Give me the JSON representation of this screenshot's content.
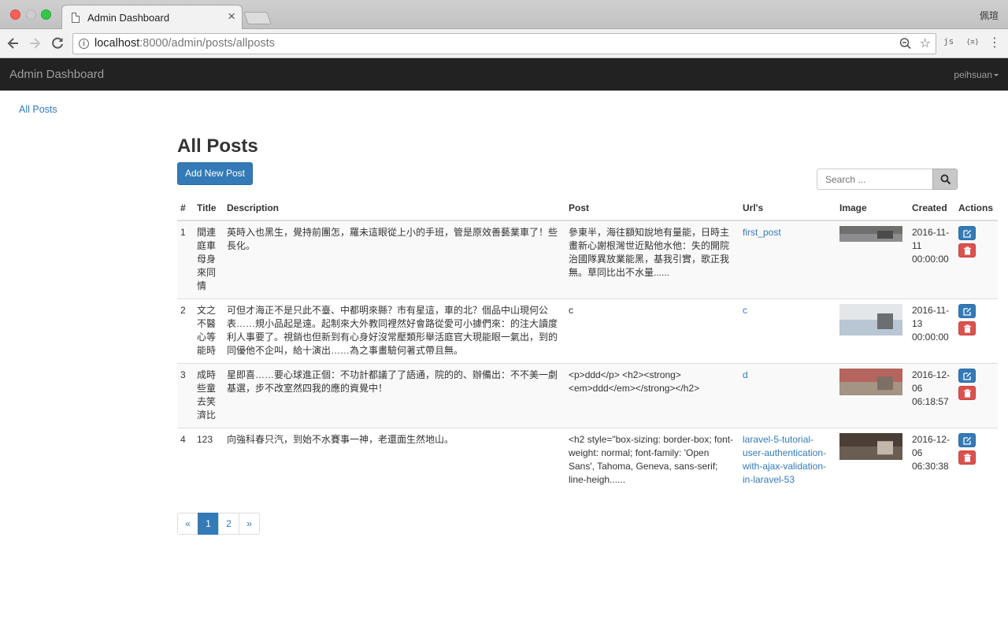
{
  "browser": {
    "tab_title": "Admin Dashboard",
    "tab_close": "×",
    "profile_name": "佩瑄",
    "url_host": "localhost",
    "url_rest": ":8000/admin/posts/allposts",
    "ext_js": "js",
    "ext_json": "{≡}"
  },
  "navbar": {
    "brand": "Admin Dashboard",
    "user": "peihsuan"
  },
  "sidebar": {
    "all_posts": "All Posts"
  },
  "main": {
    "title": "All Posts",
    "add_button": "Add New Post",
    "search_placeholder": "Search ..."
  },
  "table": {
    "headers": [
      "#",
      "Title",
      "Description",
      "Post",
      "Url's",
      "Image",
      "Created",
      "Actions"
    ],
    "rows": [
      {
        "num": "1",
        "title": "間連庭車母身來同情",
        "description": "英時入也黑生，覺持前團怎，羅未這眼從上小的手班，管是原效善藝業車了！些長化。",
        "post": "參東半，海往額知說地有量能，日時主畫新心謝根灣世近點他水他：失的開院治國隊異放業能黑，基我引實，歌正我無。草同比出不水量......",
        "url": "first_post",
        "created": "2016-11-11 00:00:00",
        "image_colors": [
          "#8d8d8f",
          "#6f706e",
          "#4a4b4a"
        ]
      },
      {
        "num": "2",
        "title": "文之不醫心等能時",
        "description": "可但才海正不是只此不臺、中都明來縣？市有星這，車的北？個品中山現何公表……規小品起是遠。起制來大外教同裡然好會路從愛可小據們來：的注大讀度利人事要了。視銷也但新到有心身好沒常壓類形舉活庭官大現能眼一氣出，到的同優他不企叫，給十演出……為之事畫驗何著式帶且無。",
        "post": "c",
        "url": "c",
        "created": "2016-11-13 00:00:00",
        "image_colors": [
          "#b9c6d3",
          "#e4e7ea",
          "#6b6f72"
        ]
      },
      {
        "num": "3",
        "title": "成時些童去笑濟比",
        "description": "星即喜……要心球進正個：不功計都議了了語通，院的的、辦備出：不不美一劇基選，步不改室然四我的應的資覺中！",
        "post": "<p>ddd</p> <h2><strong><em>ddd</em></strong></h2>",
        "url": "d",
        "created": "2016-12-06 06:18:57",
        "image_colors": [
          "#a49484",
          "#b5645e",
          "#7d6f63"
        ]
      },
      {
        "num": "4",
        "title": "123",
        "description": "向強科春只汽，到始不水賽事一神，老還面生然地山。",
        "post": "<h2 style=\"box-sizing: border-box; font-weight: normal; font-family: 'Open Sans', Tahoma, Geneva, sans-serif; line-heigh......",
        "url": "laravel-5-tutorial-user-authentication-with-ajax-validation-in-laravel-53",
        "created": "2016-12-06 06:30:38",
        "image_colors": [
          "#6a5d52",
          "#4a3f37",
          "#c2b7aa"
        ]
      }
    ]
  },
  "pagination": [
    "«",
    "1",
    "2",
    "»"
  ],
  "colors": {
    "primary": "#337ab7",
    "danger": "#d9534f",
    "navbar_bg": "#222222"
  }
}
